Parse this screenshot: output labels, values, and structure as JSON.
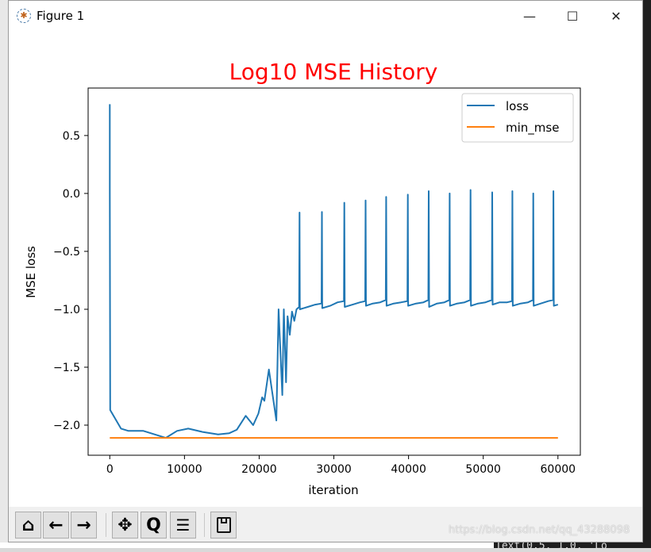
{
  "window": {
    "title": "Figure 1",
    "controls": {
      "minimize": "—",
      "maximize": "☐",
      "close": "✕"
    }
  },
  "toolbar": {
    "buttons": [
      {
        "name": "home-icon",
        "glyph": "⌂"
      },
      {
        "name": "back-arrow-icon",
        "glyph": "←"
      },
      {
        "name": "forward-arrow-icon",
        "glyph": "→"
      },
      {
        "name": "pan-move-icon",
        "glyph": "✥"
      },
      {
        "name": "zoom-magnifier-icon",
        "glyph": "🔍"
      },
      {
        "name": "configure-subplots-icon",
        "glyph": "☰"
      },
      {
        "name": "save-floppy-icon",
        "glyph": "💾"
      }
    ]
  },
  "background": {
    "watermark": "https://blog.csdn.net/qq_43288098",
    "console_text": "Text(0.5, 1.0, 'Lo"
  },
  "chart_data": {
    "type": "line",
    "title": "Log10 MSE History",
    "title_color": "#ff0000",
    "xlabel": "iteration",
    "ylabel": "MSE loss",
    "xlim": [
      -2900,
      63000
    ],
    "ylim": [
      -2.26,
      0.91
    ],
    "xticks": [
      0,
      10000,
      20000,
      30000,
      40000,
      50000,
      60000
    ],
    "xtick_labels": [
      "0",
      "10000",
      "20000",
      "30000",
      "40000",
      "50000",
      "60000"
    ],
    "yticks": [
      0.5,
      0.0,
      -0.5,
      -1.0,
      -1.5,
      -2.0
    ],
    "ytick_labels": [
      "0.5",
      "0.0",
      "−0.5",
      "−1.0",
      "−1.5",
      "−2.0"
    ],
    "grid": false,
    "legend_position": "top-right",
    "series": [
      {
        "name": "loss",
        "color": "#1f77b4",
        "points": [
          [
            0,
            0.77
          ],
          [
            0,
            0.05
          ],
          [
            60,
            -1.87
          ],
          [
            1500,
            -2.03
          ],
          [
            2500,
            -2.05
          ],
          [
            4500,
            -2.05
          ],
          [
            6000,
            -2.08
          ],
          [
            7500,
            -2.11
          ],
          [
            9000,
            -2.05
          ],
          [
            10500,
            -2.03
          ],
          [
            12500,
            -2.06
          ],
          [
            14500,
            -2.08
          ],
          [
            16000,
            -2.07
          ],
          [
            17000,
            -2.04
          ],
          [
            18200,
            -1.92
          ],
          [
            19200,
            -2.0
          ],
          [
            19900,
            -1.9
          ],
          [
            20400,
            -1.76
          ],
          [
            20700,
            -1.79
          ],
          [
            21300,
            -1.52
          ],
          [
            22300,
            -1.96
          ],
          [
            22600,
            -1.0
          ],
          [
            23100,
            -1.74
          ],
          [
            23300,
            -1.0
          ],
          [
            23600,
            -1.63
          ],
          [
            23800,
            -1.06
          ],
          [
            24100,
            -1.22
          ],
          [
            24400,
            -1.02
          ],
          [
            24700,
            -1.1
          ],
          [
            25000,
            -1.0
          ],
          [
            25350,
            -0.98
          ],
          [
            25400,
            -0.165
          ],
          [
            25450,
            -1.0
          ],
          [
            26500,
            -0.98
          ],
          [
            27500,
            -0.96
          ],
          [
            28350,
            -0.95
          ],
          [
            28400,
            -0.16
          ],
          [
            28450,
            -0.99
          ],
          [
            29500,
            -0.97
          ],
          [
            30500,
            -0.94
          ],
          [
            31350,
            -0.93
          ],
          [
            31400,
            -0.08
          ],
          [
            31450,
            -0.98
          ],
          [
            32500,
            -0.96
          ],
          [
            33500,
            -0.94
          ],
          [
            34200,
            -0.93
          ],
          [
            34250,
            -0.06
          ],
          [
            34300,
            -0.97
          ],
          [
            35200,
            -0.95
          ],
          [
            36200,
            -0.94
          ],
          [
            36950,
            -0.92
          ],
          [
            37000,
            -0.03
          ],
          [
            37050,
            -0.97
          ],
          [
            38000,
            -0.95
          ],
          [
            39000,
            -0.94
          ],
          [
            39850,
            -0.93
          ],
          [
            39900,
            -0.01
          ],
          [
            39950,
            -0.97
          ],
          [
            41000,
            -0.95
          ],
          [
            42000,
            -0.94
          ],
          [
            42650,
            -0.92
          ],
          [
            42700,
            0.02
          ],
          [
            42750,
            -0.98
          ],
          [
            43800,
            -0.95
          ],
          [
            44800,
            -0.94
          ],
          [
            45450,
            -0.92
          ],
          [
            45500,
            0.0
          ],
          [
            45550,
            -0.97
          ],
          [
            46500,
            -0.95
          ],
          [
            47500,
            -0.94
          ],
          [
            48250,
            -0.92
          ],
          [
            48300,
            0.03
          ],
          [
            48350,
            -0.97
          ],
          [
            49300,
            -0.95
          ],
          [
            50300,
            -0.94
          ],
          [
            51150,
            -0.92
          ],
          [
            51200,
            0.01
          ],
          [
            51250,
            -0.96
          ],
          [
            52200,
            -0.94
          ],
          [
            53200,
            -0.94
          ],
          [
            53850,
            -0.93
          ],
          [
            53900,
            0.02
          ],
          [
            53950,
            -0.97
          ],
          [
            55000,
            -0.95
          ],
          [
            56000,
            -0.94
          ],
          [
            56650,
            -0.92
          ],
          [
            56700,
            0.0
          ],
          [
            56750,
            -0.97
          ],
          [
            57700,
            -0.95
          ],
          [
            58700,
            -0.93
          ],
          [
            59350,
            -0.92
          ],
          [
            59400,
            0.02
          ],
          [
            59450,
            -0.97
          ],
          [
            60000,
            -0.96
          ]
        ]
      },
      {
        "name": "min_mse",
        "color": "#ff7f0e",
        "points": [
          [
            0,
            -2.11
          ],
          [
            60000,
            -2.11
          ]
        ]
      }
    ]
  }
}
